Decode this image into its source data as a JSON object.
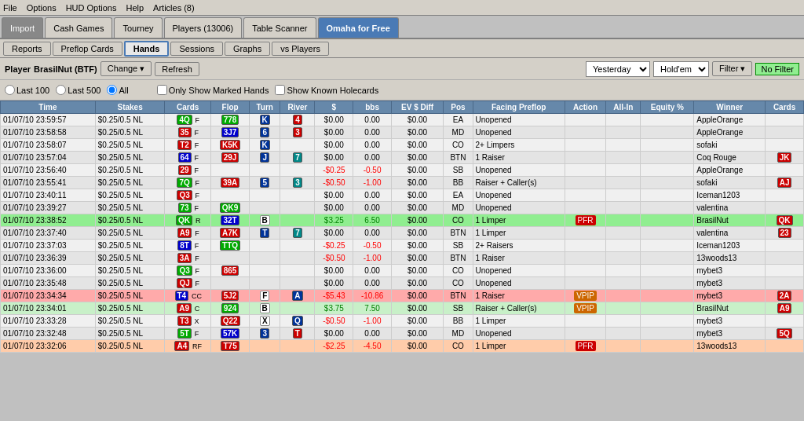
{
  "menu": {
    "items": [
      "File",
      "Options",
      "HUD Options",
      "Help",
      "Articles (8)"
    ]
  },
  "tabs": [
    {
      "label": "Import",
      "type": "import"
    },
    {
      "label": "Cash Games",
      "type": "normal"
    },
    {
      "label": "Tourney",
      "type": "normal"
    },
    {
      "label": "Players (13006)",
      "type": "normal"
    },
    {
      "label": "Table Scanner",
      "type": "normal"
    },
    {
      "label": "Omaha for Free",
      "type": "active"
    }
  ],
  "sub_tabs": [
    "Reports",
    "Preflop Cards",
    "Hands",
    "Sessions",
    "Graphs",
    "vs Players"
  ],
  "active_sub_tab": "Hands",
  "controls": {
    "player_label": "Player",
    "player_name": "BrasilNut (BTF)",
    "change_btn": "Change ▾",
    "refresh_btn": "Refresh",
    "period": "Yesterday",
    "game_type": "Hold'em",
    "filter_btn": "Filter ▾",
    "no_filter": "No Filter"
  },
  "radio": {
    "last100": "Last 100",
    "last500": "Last 500",
    "all": "All",
    "only_marked": "Only Show Marked Hands",
    "show_holecards": "Show Known Holecards"
  },
  "table": {
    "headers": [
      "Time",
      "Stakes",
      "Cards",
      "Flop",
      "Turn",
      "River",
      "$",
      "bbs",
      "EV $ Diff",
      "Pos",
      "Facing Preflop",
      "Action",
      "All-In",
      "Equity %",
      "Winner",
      "Cards"
    ],
    "rows": [
      {
        "time": "01/07/10 23:59:57",
        "stakes": "$0.25/0.5 NL",
        "cards_mine": "4Q",
        "cards_mine_color": "green",
        "street": "F",
        "flop": "778",
        "flop_color": "green",
        "turn": "K",
        "turn_color": "dark-blue",
        "river": "4",
        "river_color": "red",
        "dollar": "$0.00",
        "bbs": "0.00",
        "ev": "$0.00",
        "pos": "EA",
        "facing": "Unopened",
        "action": "",
        "allin": "",
        "equity": "",
        "winner": "AppleOrange",
        "wcards": "",
        "row_class": ""
      },
      {
        "time": "01/07/10 23:58:58",
        "stakes": "$0.25/0.5 NL",
        "cards_mine": "35",
        "cards_mine_color": "red",
        "street": "F",
        "flop": "3J7",
        "flop_color": "blue",
        "turn": "6",
        "turn_color": "dark-blue",
        "river": "3",
        "river_color": "red",
        "dollar": "$0.00",
        "bbs": "0.00",
        "ev": "$0.00",
        "pos": "MD",
        "facing": "Unopened",
        "action": "",
        "allin": "",
        "equity": "",
        "winner": "AppleOrange",
        "wcards": "",
        "row_class": ""
      },
      {
        "time": "01/07/10 23:58:07",
        "stakes": "$0.25/0.5 NL",
        "cards_mine": "T2",
        "cards_mine_color": "red",
        "street": "F",
        "flop": "K5K",
        "flop_color": "red",
        "turn": "K",
        "turn_color": "dark-blue",
        "river": "",
        "river_color": "",
        "dollar": "$0.00",
        "bbs": "0.00",
        "ev": "$0.00",
        "pos": "CO",
        "facing": "2+ Limpers",
        "action": "",
        "allin": "",
        "equity": "",
        "winner": "sofaki",
        "wcards": "",
        "row_class": ""
      },
      {
        "time": "01/07/10 23:57:04",
        "stakes": "$0.25/0.5 NL",
        "cards_mine": "64",
        "cards_mine_color": "blue",
        "street": "F",
        "flop": "29J",
        "flop_color": "red",
        "turn": "J",
        "turn_color": "dark-blue",
        "river": "7",
        "river_color": "teal",
        "dollar": "$0.00",
        "bbs": "0.00",
        "ev": "$0.00",
        "pos": "BTN",
        "facing": "1 Raiser",
        "action": "",
        "allin": "",
        "equity": "",
        "winner": "Coq Rouge",
        "wcards": "JK",
        "row_class": ""
      },
      {
        "time": "01/07/10 23:56:40",
        "stakes": "$0.25/0.5 NL",
        "cards_mine": "29",
        "cards_mine_color": "red",
        "street": "F",
        "flop": "",
        "flop_color": "",
        "turn": "",
        "turn_color": "",
        "river": "",
        "river_color": "",
        "dollar": "-$0.25",
        "bbs": "-0.50",
        "ev": "$0.00",
        "pos": "SB",
        "facing": "Unopened",
        "action": "",
        "allin": "",
        "equity": "",
        "winner": "AppleOrange",
        "wcards": "",
        "row_class": ""
      },
      {
        "time": "01/07/10 23:55:41",
        "stakes": "$0.25/0.5 NL",
        "cards_mine": "7Q",
        "cards_mine_color": "green",
        "street": "F",
        "flop": "39A",
        "flop_color": "red",
        "turn": "5",
        "turn_color": "dark-blue",
        "river": "3",
        "river_color": "teal",
        "dollar": "-$0.50",
        "bbs": "-1.00",
        "ev": "$0.00",
        "pos": "BB",
        "facing": "Raiser + Caller(s)",
        "action": "",
        "allin": "",
        "equity": "",
        "winner": "sofaki",
        "wcards": "AJ",
        "row_class": ""
      },
      {
        "time": "01/07/10 23:40:11",
        "stakes": "$0.25/0.5 NL",
        "cards_mine": "Q3",
        "cards_mine_color": "red",
        "street": "F",
        "flop": "",
        "flop_color": "",
        "turn": "",
        "turn_color": "",
        "river": "",
        "river_color": "",
        "dollar": "$0.00",
        "bbs": "0.00",
        "ev": "$0.00",
        "pos": "EA",
        "facing": "Unopened",
        "action": "",
        "allin": "",
        "equity": "",
        "winner": "Iceman1203",
        "wcards": "",
        "row_class": ""
      },
      {
        "time": "01/07/10 23:39:27",
        "stakes": "$0.25/0.5 NL",
        "cards_mine": "73",
        "cards_mine_color": "green",
        "street": "F",
        "flop": "QK9",
        "flop_color": "green",
        "turn": "",
        "turn_color": "",
        "river": "",
        "river_color": "",
        "dollar": "$0.00",
        "bbs": "0.00",
        "ev": "$0.00",
        "pos": "MD",
        "facing": "Unopened",
        "action": "",
        "allin": "",
        "equity": "",
        "winner": "valentina",
        "wcards": "",
        "row_class": ""
      },
      {
        "time": "01/07/10 23:38:52",
        "stakes": "$0.25/0.5 NL",
        "cards_mine": "QK",
        "cards_mine_color": "green",
        "street": "R",
        "flop": "32T",
        "flop_color": "blue",
        "turn": "B",
        "turn_color": "plain",
        "river": "",
        "river_color": "",
        "dollar": "$3.25",
        "bbs": "6.50",
        "ev": "$0.00",
        "pos": "CO",
        "facing": "1 Limper",
        "action": "PFR",
        "allin": "",
        "equity": "",
        "winner": "BrasilNut",
        "wcards": "QK",
        "row_class": "highlighted"
      },
      {
        "time": "01/07/10 23:37:40",
        "stakes": "$0.25/0.5 NL",
        "cards_mine": "A9",
        "cards_mine_color": "red",
        "street": "F",
        "flop": "A7K",
        "flop_color": "red",
        "turn": "T",
        "turn_color": "dark-blue",
        "river": "7",
        "river_color": "teal",
        "dollar": "$0.00",
        "bbs": "0.00",
        "ev": "$0.00",
        "pos": "BTN",
        "facing": "1 Limper",
        "action": "",
        "allin": "",
        "equity": "",
        "winner": "valentina",
        "wcards": "23",
        "row_class": ""
      },
      {
        "time": "01/07/10 23:37:03",
        "stakes": "$0.25/0.5 NL",
        "cards_mine": "8T",
        "cards_mine_color": "blue",
        "street": "F",
        "flop": "TTQ",
        "flop_color": "green",
        "turn": "",
        "turn_color": "",
        "river": "",
        "river_color": "",
        "dollar": "-$0.25",
        "bbs": "-0.50",
        "ev": "$0.00",
        "pos": "SB",
        "facing": "2+ Raisers",
        "action": "",
        "allin": "",
        "equity": "",
        "winner": "Iceman1203",
        "wcards": "",
        "row_class": ""
      },
      {
        "time": "01/07/10 23:36:39",
        "stakes": "$0.25/0.5 NL",
        "cards_mine": "3A",
        "cards_mine_color": "red",
        "street": "F",
        "flop": "",
        "flop_color": "",
        "turn": "",
        "turn_color": "",
        "river": "",
        "river_color": "",
        "dollar": "-$0.50",
        "bbs": "-1.00",
        "ev": "$0.00",
        "pos": "BTN",
        "facing": "1 Raiser",
        "action": "",
        "allin": "",
        "equity": "",
        "winner": "13woods13",
        "wcards": "",
        "row_class": ""
      },
      {
        "time": "01/07/10 23:36:00",
        "stakes": "$0.25/0.5 NL",
        "cards_mine": "Q3",
        "cards_mine_color": "green",
        "street": "F",
        "flop": "865",
        "flop_color": "red",
        "turn": "",
        "turn_color": "",
        "river": "",
        "river_color": "",
        "dollar": "$0.00",
        "bbs": "0.00",
        "ev": "$0.00",
        "pos": "CO",
        "facing": "Unopened",
        "action": "",
        "allin": "",
        "equity": "",
        "winner": "mybet3",
        "wcards": "",
        "row_class": ""
      },
      {
        "time": "01/07/10 23:35:48",
        "stakes": "$0.25/0.5 NL",
        "cards_mine": "QJ",
        "cards_mine_color": "red",
        "street": "F",
        "flop": "",
        "flop_color": "",
        "turn": "",
        "turn_color": "",
        "river": "",
        "river_color": "",
        "dollar": "$0.00",
        "bbs": "0.00",
        "ev": "$0.00",
        "pos": "CO",
        "facing": "Unopened",
        "action": "",
        "allin": "",
        "equity": "",
        "winner": "mybet3",
        "wcards": "",
        "row_class": ""
      },
      {
        "time": "01/07/10 23:34:34",
        "stakes": "$0.25/0.5 NL",
        "cards_mine": "T4",
        "cards_mine_color": "blue",
        "street": "CC",
        "flop": "5J2",
        "flop_color": "red",
        "turn": "F",
        "turn_color": "plain",
        "river": "A",
        "river_color": "dark-blue",
        "dollar": "-$5.43",
        "bbs": "-10.86",
        "ev": "$0.00",
        "pos": "BTN",
        "facing": "1 Raiser",
        "action": "VPIP",
        "allin": "",
        "equity": "",
        "winner": "mybet3",
        "wcards": "2A",
        "row_class": "red-row"
      },
      {
        "time": "01/07/10 23:34:01",
        "stakes": "$0.25/0.5 NL",
        "cards_mine": "A9",
        "cards_mine_color": "red",
        "street": "C",
        "flop": "924",
        "flop_color": "green",
        "turn": "B",
        "turn_color": "plain",
        "river": "",
        "river_color": "",
        "dollar": "$3.75",
        "bbs": "7.50",
        "ev": "$0.00",
        "pos": "SB",
        "facing": "Raiser + Caller(s)",
        "action": "VPIP",
        "allin": "",
        "equity": "",
        "winner": "BrasilNut",
        "wcards": "A9",
        "row_class": "highlighted2"
      },
      {
        "time": "01/07/10 23:33:28",
        "stakes": "$0.25/0.5 NL",
        "cards_mine": "T3",
        "cards_mine_color": "red",
        "street": "X",
        "flop": "Q22",
        "flop_color": "red",
        "turn": "X",
        "turn_color": "plain",
        "river": "Q",
        "river_color": "dark-blue",
        "dollar": "-$0.50",
        "bbs": "-1.00",
        "ev": "$0.00",
        "pos": "BB",
        "facing": "1 Limper",
        "action": "",
        "allin": "",
        "equity": "",
        "winner": "mybet3",
        "wcards": "",
        "row_class": ""
      },
      {
        "time": "01/07/10 23:32:48",
        "stakes": "$0.25/0.5 NL",
        "cards_mine": "5T",
        "cards_mine_color": "green",
        "street": "F",
        "flop": "57K",
        "flop_color": "blue",
        "turn": "3",
        "turn_color": "dark-blue",
        "river": "T",
        "river_color": "red",
        "dollar": "$0.00",
        "bbs": "0.00",
        "ev": "$0.00",
        "pos": "MD",
        "facing": "Unopened",
        "action": "",
        "allin": "",
        "equity": "",
        "winner": "mybet3",
        "wcards": "5Q",
        "row_class": ""
      },
      {
        "time": "01/07/10 23:32:06",
        "stakes": "$0.25/0.5 NL",
        "cards_mine": "A4",
        "cards_mine_color": "red",
        "street": "RF",
        "flop": "T75",
        "flop_color": "red",
        "turn": "",
        "turn_color": "",
        "river": "",
        "river_color": "",
        "dollar": "-$2.25",
        "bbs": "-4.50",
        "ev": "$0.00",
        "pos": "CO",
        "facing": "1 Limper",
        "action": "PFR",
        "allin": "",
        "equity": "",
        "winner": "13woods13",
        "wcards": "",
        "row_class": "salmon-row"
      }
    ]
  }
}
